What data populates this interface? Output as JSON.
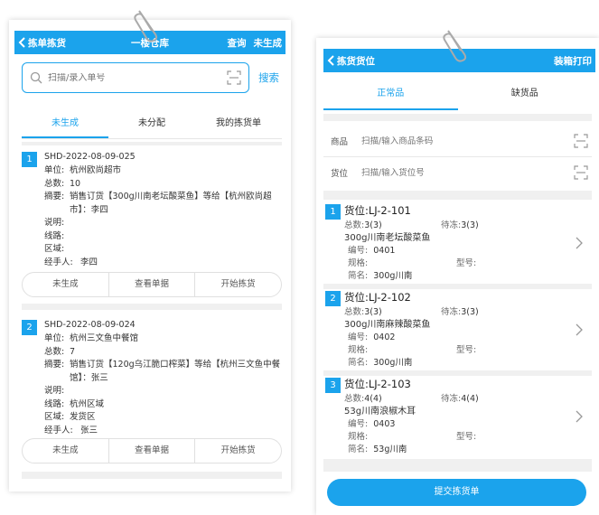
{
  "left": {
    "header": {
      "back_label": "拣单拣货",
      "title": "一楼仓库",
      "query": "查询",
      "status": "未生成"
    },
    "search": {
      "placeholder": "扫描/录入单号",
      "button": "搜索"
    },
    "tabs": [
      "未生成",
      "未分配",
      "我的拣货单"
    ],
    "labels": {
      "unit": "单位:",
      "total": "总数:",
      "summary": "摘要:",
      "note": "说明:",
      "route": "线路:",
      "area": "区域:",
      "handler": "经手人:"
    },
    "orders": [
      {
        "index": "1",
        "code": "SHD-2022-08-09-025",
        "unit": "杭州欧尚超市",
        "total": "10",
        "summary": "销售订货【300g川南老坛酸菜鱼】等给【杭州欧尚超市】：李四",
        "note": "",
        "route": "",
        "area": "",
        "handler": "李四",
        "actions": [
          "未生成",
          "查看单据",
          "开始拣货"
        ]
      },
      {
        "index": "2",
        "code": "SHD-2022-08-09-024",
        "unit": "杭州三文鱼中餐馆",
        "total": "7",
        "summary": "销售订货【120g乌江脆口榨菜】等给【杭州三文鱼中餐馆】：张三",
        "note": "",
        "route": "杭州区域",
        "area": "发货区",
        "handler": "张三",
        "actions": [
          "未生成",
          "查看单据",
          "开始拣货"
        ]
      }
    ]
  },
  "right": {
    "header": {
      "back_label": "拣货货位",
      "print": "装箱打印"
    },
    "tabs": [
      "正常品",
      "缺货品"
    ],
    "fields": [
      {
        "label": "商品",
        "placeholder": "扫描/输入商品条码"
      },
      {
        "label": "货位",
        "placeholder": "扫描/输入货位号"
      }
    ],
    "labels": {
      "loc": "货位:",
      "total": "总数:",
      "pending": "待冻:",
      "code": "编号:",
      "spec": "规格:",
      "model": "型号:",
      "short": "简名:"
    },
    "locations": [
      {
        "index": "1",
        "loc": "LJ-2-101",
        "total": "3(3)",
        "pending": "3(3)",
        "product": "300g川南老坛酸菜鱼",
        "code": "0401",
        "spec": "",
        "model": "",
        "short": "300g川南"
      },
      {
        "index": "2",
        "loc": "LJ-2-102",
        "total": "3(3)",
        "pending": "3(3)",
        "product": "300g川南麻辣酸菜鱼",
        "code": "0402",
        "spec": "",
        "model": "",
        "short": "300g川南"
      },
      {
        "index": "3",
        "loc": "LJ-2-103",
        "total": "4(4)",
        "pending": "4(4)",
        "product": "53g川南浪椒木耳",
        "code": "0403",
        "spec": "",
        "model": "",
        "short": "53g川南"
      }
    ],
    "submit": "提交拣货单"
  },
  "icons": {
    "back": "chevron-left-icon",
    "search": "search-icon",
    "scan": "scan-icon",
    "chevron": "chevron-right-icon",
    "clip": "paperclip-icon"
  },
  "colors": {
    "accent": "#1ba3ec",
    "divider": "#f0f0f0"
  }
}
